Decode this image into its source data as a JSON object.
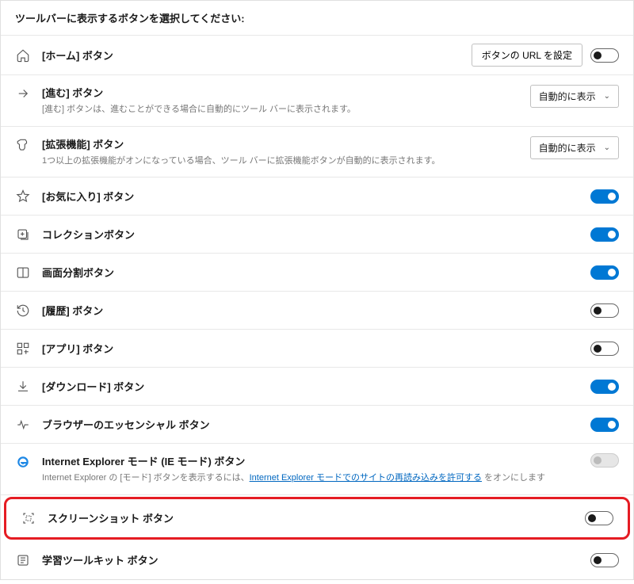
{
  "header": "ツールバーに表示するボタンを選択してください:",
  "controls": {
    "set_url_btn": "ボタンの URL を設定",
    "auto_show": "自動的に表示"
  },
  "items": {
    "home": {
      "title": "[ホーム] ボタン"
    },
    "forward": {
      "title": "[進む] ボタン",
      "desc": "[進む] ボタンは、進むことができる場合に自動的にツール バーに表示されます。"
    },
    "extensions": {
      "title": "[拡張機能] ボタン",
      "desc": "1つ以上の拡張機能がオンになっている場合、ツール バーに拡張機能ボタンが自動的に表示されます。"
    },
    "favorites": {
      "title": "[お気に入り] ボタン"
    },
    "collections": {
      "title": "コレクションボタン"
    },
    "splitscreen": {
      "title": "画面分割ボタン"
    },
    "history": {
      "title": "[履歴] ボタン"
    },
    "apps": {
      "title": "[アプリ] ボタン"
    },
    "downloads": {
      "title": "[ダウンロード] ボタン"
    },
    "essentials": {
      "title": "ブラウザーのエッセンシャル ボタン"
    },
    "ie": {
      "title": "Internet Explorer モード (IE モード) ボタン",
      "desc_before": "Internet Explorer の [モード] ボタンを表示するには、",
      "link": "Internet Explorer モードでのサイトの再読み込みを許可する",
      "desc_after": " をオンにします"
    },
    "screenshot": {
      "title": "スクリーンショット ボタン"
    },
    "immersive": {
      "title": "学習ツールキット ボタン"
    }
  }
}
